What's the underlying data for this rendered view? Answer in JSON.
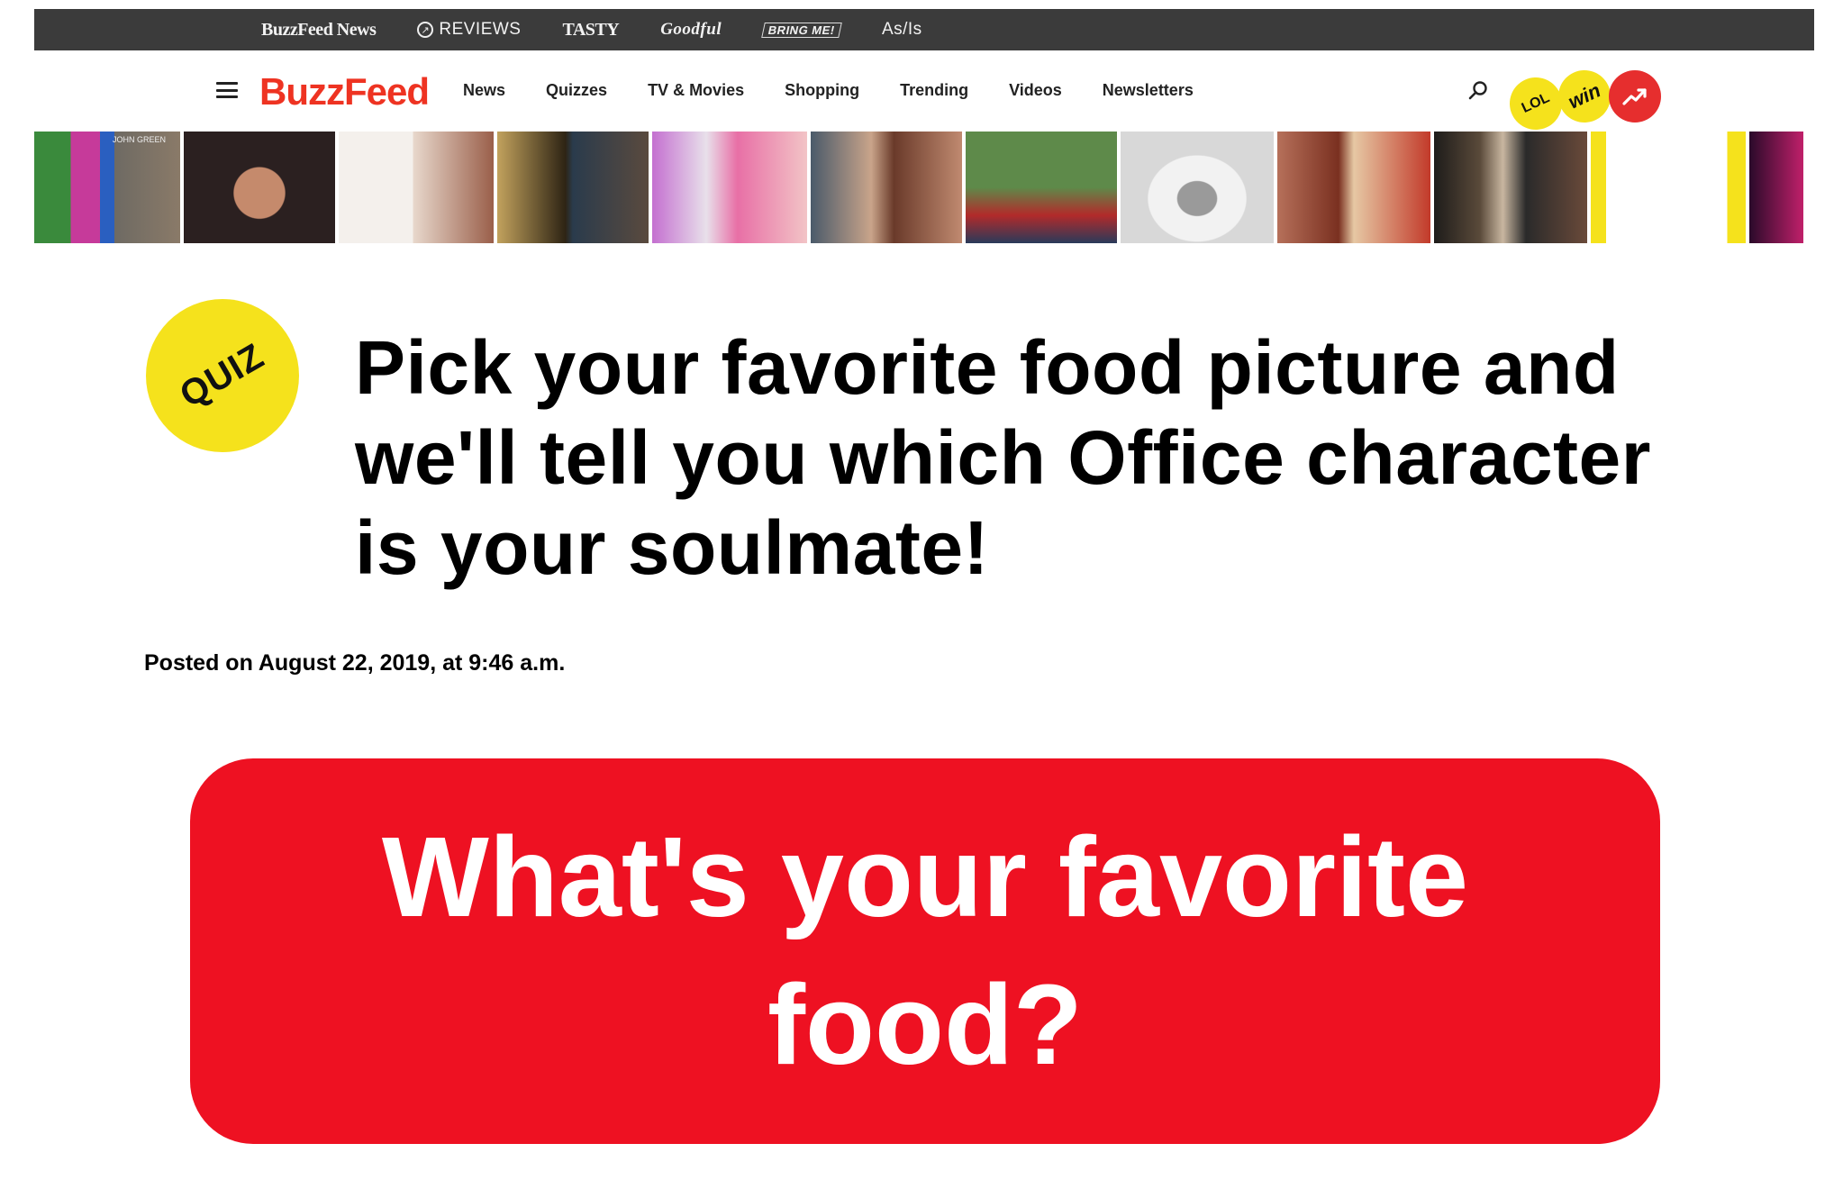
{
  "network_bar": {
    "brands": [
      "BuzzFeed News",
      "REVIEWS",
      "TASTY",
      "Goodful",
      "BRING ME!",
      "As/Is"
    ]
  },
  "nav": {
    "logo": "BuzzFeed",
    "links": [
      "News",
      "Quizzes",
      "TV & Movies",
      "Shopping",
      "Trending",
      "Videos",
      "Newsletters"
    ],
    "badges": [
      "LOL",
      "win",
      "trending-icon"
    ]
  },
  "strip": {
    "tiles": 13,
    "tile_text": "JOHN GREEN"
  },
  "article": {
    "badge": "QUIZ",
    "title": "Pick your favorite food picture and we'll tell you which Office character is your soulmate!",
    "posted": "Posted on August 22, 2019, at 9:46 a.m."
  },
  "question": {
    "text": "What's your favorite food?"
  },
  "colors": {
    "brand_red": "#ee3322",
    "card_red": "#ee1122",
    "badge_yellow": "#f5e21c",
    "topbar": "#3b3b3b"
  }
}
